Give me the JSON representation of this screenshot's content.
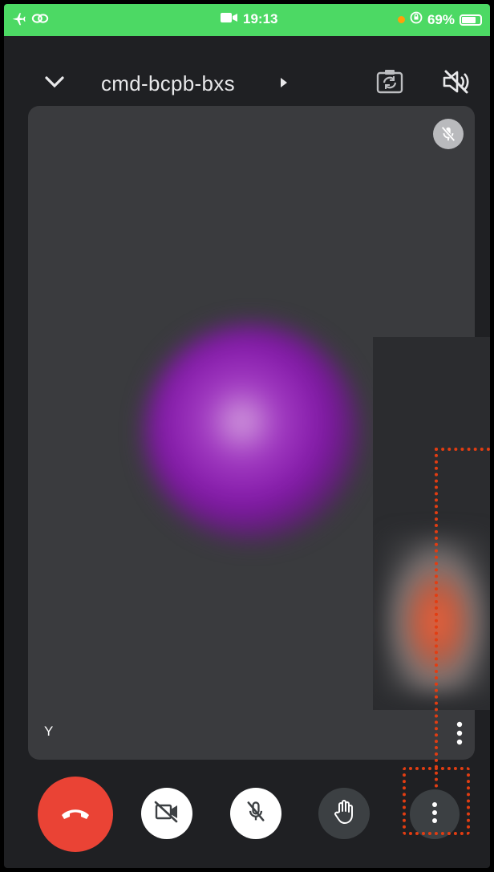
{
  "status_bar": {
    "time": "19:13",
    "battery": "69%",
    "background": "#4cd964",
    "left_icons": [
      "airplane-icon",
      "link-icon"
    ],
    "center_icon": "video-recording-icon",
    "right_icons": [
      "orange-dot",
      "orientation-lock-icon",
      "battery-icon"
    ]
  },
  "top_bar": {
    "meeting_code": "cmd-bcpb-bxs",
    "icons": [
      "chevron-down-icon",
      "caret-right-icon",
      "camera-flip-icon",
      "speaker-muted-icon"
    ]
  },
  "participant_tile": {
    "name": "Y",
    "muted": true,
    "icons": [
      "mic-off-icon",
      "more-vertical-icon"
    ]
  },
  "self_view": {
    "icons": []
  },
  "controls": [
    {
      "name": "end-call-button",
      "icon": "phone-hangup-icon",
      "color": "#ea4335"
    },
    {
      "name": "camera-toggle-button",
      "icon": "camera-off-icon",
      "color": "#ffffff"
    },
    {
      "name": "mic-toggle-button",
      "icon": "mic-off-icon",
      "color": "#ffffff"
    },
    {
      "name": "raise-hand-button",
      "icon": "hand-icon",
      "color": "#3c4043"
    },
    {
      "name": "more-options-button",
      "icon": "more-vertical-icon",
      "color": "#3c4043"
    }
  ],
  "accent_colors": {
    "highlight": "#e23d12",
    "tile_background": "#3a3b3e",
    "app_background": "#1f2023"
  }
}
